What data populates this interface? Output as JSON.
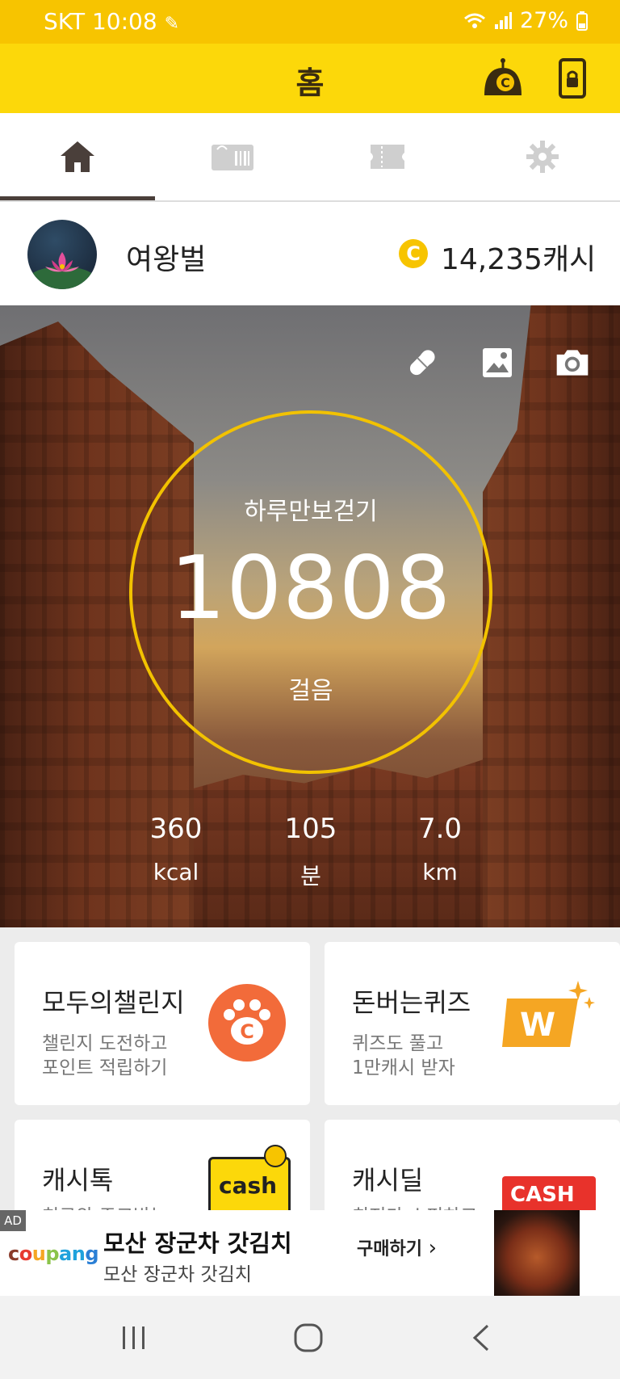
{
  "status_bar": {
    "carrier": "SKT",
    "time": "10:08",
    "battery": "27%"
  },
  "header": {
    "title": "홈"
  },
  "tabs": [
    {
      "name": "home",
      "icon": "home-icon",
      "active": true
    },
    {
      "name": "coupon",
      "icon": "coupon-icon",
      "active": false
    },
    {
      "name": "ticket",
      "icon": "ticket-icon",
      "active": false
    },
    {
      "name": "settings",
      "icon": "gear-icon",
      "active": false
    }
  ],
  "profile": {
    "username": "여왕벌",
    "cash": "14,235캐시",
    "coin_symbol": "C"
  },
  "pedometer": {
    "title": "하루만보걷기",
    "steps": "10808",
    "unit": "걸음",
    "stats": [
      {
        "value": "360",
        "unit": "kcal"
      },
      {
        "value": "105",
        "unit": "분"
      },
      {
        "value": "7.0",
        "unit": "km"
      }
    ]
  },
  "cards": [
    {
      "title": "모두의챌린지",
      "sub1": "챌린지 도전하고",
      "sub2": "포인트 적립하기",
      "icon": "paw-coin-icon"
    },
    {
      "title": "돈버는퀴즈",
      "sub1": "퀴즈도 풀고",
      "sub2": "1만캐시 받자",
      "icon": "quiz-logo-icon"
    },
    {
      "title": "캐시톡",
      "sub1": "친구와 주고받는",
      "sub2": "",
      "icon": "cash-talk-logo",
      "logo_text": "cash"
    },
    {
      "title": "캐시딜",
      "sub1": "최저가 쇼핑하고",
      "sub2": "",
      "icon": "cash-deal-logo",
      "logo_text": "CASH"
    }
  ],
  "ad": {
    "tag": "AD",
    "brand": "coupang",
    "title": "모산 장군차 갓김치",
    "subtitle": "모산 장군차 갓김치",
    "cta": "구매하기"
  },
  "colors": {
    "accent": "#f7c400",
    "header": "#fcd80a",
    "paw": "#f26b3a",
    "quiz": "#f5a623",
    "deal": "#e8322b"
  }
}
